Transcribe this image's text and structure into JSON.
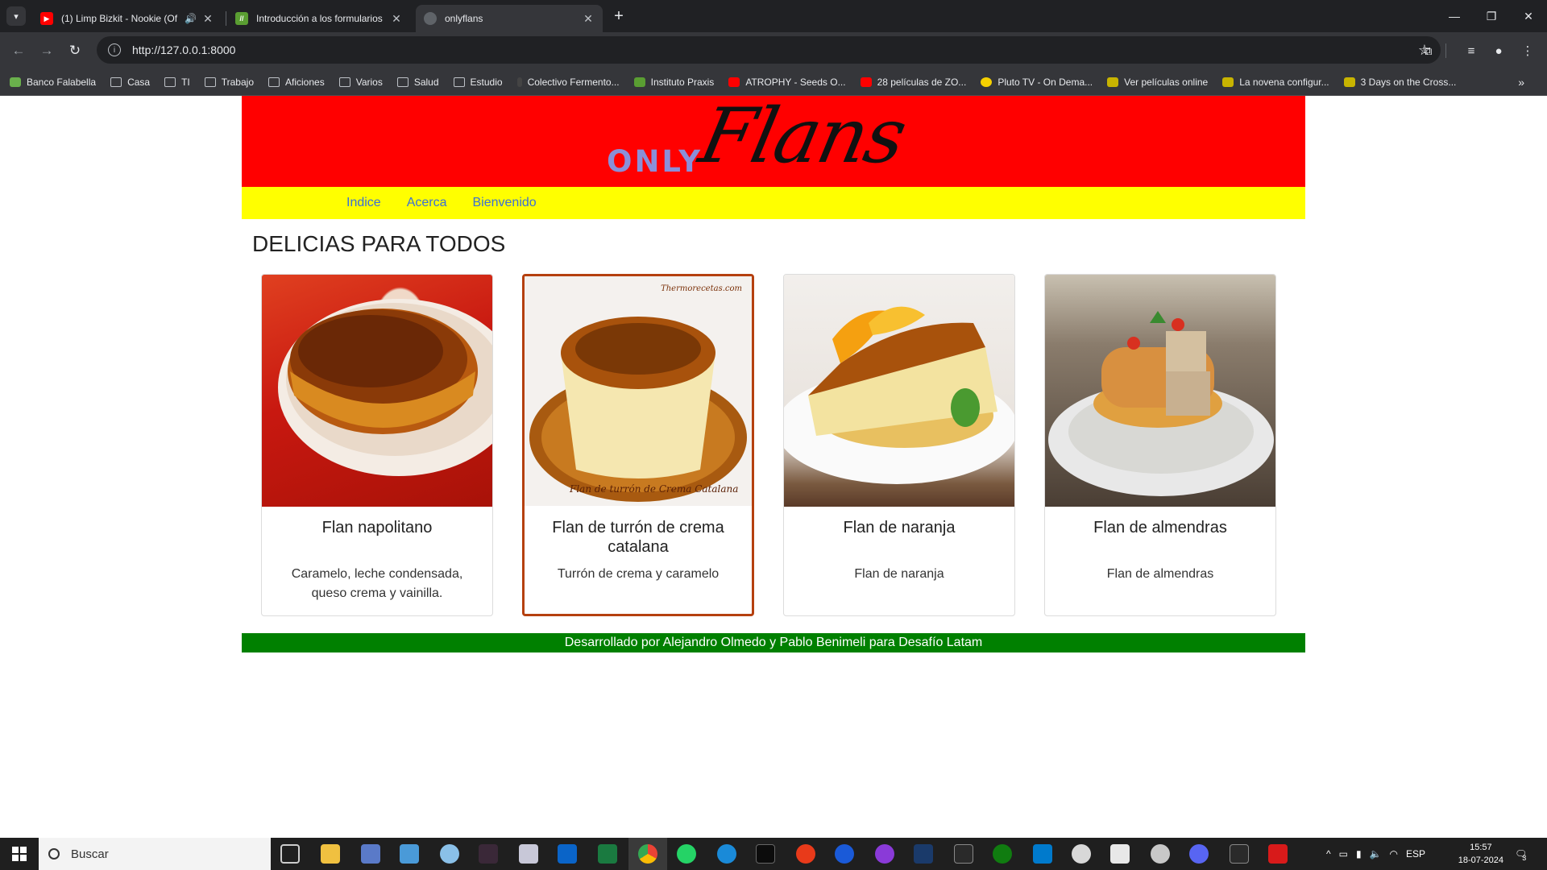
{
  "browser": {
    "tabs": [
      {
        "title": "(1) Limp Bizkit - Nookie (Of",
        "favicon": "youtube-icon",
        "color": "#ff0000"
      },
      {
        "title": "Introducción a los formularios /",
        "favicon": "document-icon",
        "color": "#5a9e32"
      },
      {
        "title": "onlyflans",
        "favicon": "globe-icon",
        "color": "#5f6368"
      }
    ],
    "url": "http://127.0.0.1:8000",
    "bookmarks": [
      {
        "label": "Banco Falabella",
        "icon": "bank-icon"
      },
      {
        "label": "Casa",
        "icon": "folder-icon"
      },
      {
        "label": "TI",
        "icon": "folder-icon"
      },
      {
        "label": "Trabajo",
        "icon": "folder-icon"
      },
      {
        "label": "Aficiones",
        "icon": "folder-icon"
      },
      {
        "label": "Varios",
        "icon": "folder-icon"
      },
      {
        "label": "Salud",
        "icon": "folder-icon"
      },
      {
        "label": "Estudio",
        "icon": "folder-icon"
      },
      {
        "label": "Colectivo Fermento...",
        "icon": "site-icon"
      },
      {
        "label": "Instituto Praxis",
        "icon": "site-icon"
      },
      {
        "label": "ATROPHY - Seeds O...",
        "icon": "youtube-icon"
      },
      {
        "label": "28 películas de ZO...",
        "icon": "youtube-icon"
      },
      {
        "label": "Pluto TV - On Dema...",
        "icon": "tv-icon"
      },
      {
        "label": "Ver películas online",
        "icon": "play-icon"
      },
      {
        "label": "La novena configur...",
        "icon": "play-icon"
      },
      {
        "label": "3 Days on the Cross...",
        "icon": "play-icon"
      }
    ]
  },
  "site": {
    "logo_only": "ONLY",
    "logo_flans": "Flans",
    "nav": [
      "Indice",
      "Acerca",
      "Bienvenido"
    ],
    "heading": "DELICIAS PARA TODOS",
    "cards": [
      {
        "title": "Flan napolitano",
        "description": "Caramelo, leche condensada, queso crema y vainilla."
      },
      {
        "title": "Flan de turrón de crema catalana",
        "description": "Turrón de crema y caramelo",
        "image_caption": "Flan de turrón de Crema Catalana",
        "image_watermark": "Thermorecetas.com"
      },
      {
        "title": "Flan de naranja",
        "description": "Flan de naranja"
      },
      {
        "title": "Flan de almendras",
        "description": "Flan de almendras"
      }
    ],
    "footer": "Desarrollado por Alejandro Olmedo y Pablo Benimeli para Desafío Latam",
    "colors": {
      "header": "#ff0000",
      "nav": "#ffff00",
      "footer": "#008000",
      "link": "#3b6fd6"
    }
  },
  "taskbar": {
    "search_placeholder": "Buscar",
    "language": "ESP",
    "time": "15:57",
    "date": "18-07-2024",
    "notifications": "3"
  }
}
